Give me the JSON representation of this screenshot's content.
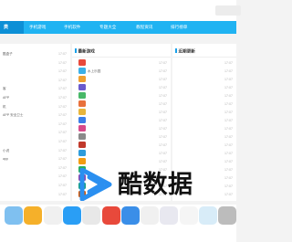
{
  "nav": {
    "items": [
      "手机游戏",
      "手机软件",
      "专题大全",
      "教程资讯",
      "排行榜单"
    ],
    "first": "类"
  },
  "left": {
    "rows": [
      {
        "tag": "",
        "name": "酷盒子",
        "date": "17:07"
      },
      {
        "tag": "",
        "name": "",
        "date": "17:07"
      },
      {
        "tag": "",
        "name": "",
        "date": "17:07"
      },
      {
        "tag": "",
        "name": "",
        "date": "17:07"
      },
      {
        "tag": "",
        "name": "客",
        "date": "17:07"
      },
      {
        "tag": "",
        "name": "APP",
        "date": "17:07"
      },
      {
        "tag": "",
        "name": "机",
        "date": "17:07"
      },
      {
        "tag": "",
        "name": "APP 安全卫士",
        "date": "17:07"
      },
      {
        "tag": "",
        "name": "",
        "date": "17:07"
      },
      {
        "tag": "",
        "name": "",
        "date": "17:07"
      },
      {
        "tag": "",
        "name": "",
        "date": "17:07"
      },
      {
        "tag": "",
        "name": "小说",
        "date": "17:07"
      },
      {
        "tag": "",
        "name": "app",
        "date": "17:07"
      },
      {
        "tag": "",
        "name": "",
        "date": "17:07"
      },
      {
        "tag": "",
        "name": "",
        "date": "17:07"
      },
      {
        "tag": "",
        "name": "",
        "date": "17:07"
      },
      {
        "tag": "",
        "name": "",
        "date": "17:07"
      }
    ]
  },
  "middle": {
    "title": "最新游戏",
    "subtitle": "",
    "rows": [
      {
        "name": "",
        "date": "17:07",
        "color": "#e8493b"
      },
      {
        "name": "水上乐园",
        "date": "17:07",
        "color": "#3bb0e8"
      },
      {
        "name": "",
        "date": "17:07",
        "color": "#f0a030"
      },
      {
        "name": "",
        "date": "17:07",
        "color": "#6a5acd"
      },
      {
        "name": "",
        "date": "17:07",
        "color": "#48b868"
      },
      {
        "name": "",
        "date": "17:07",
        "color": "#e8703b"
      },
      {
        "name": "",
        "date": "17:07",
        "color": "#e8b53b"
      },
      {
        "name": "",
        "date": "17:07",
        "color": "#3b7ee8"
      },
      {
        "name": "",
        "date": "17:07",
        "color": "#d84a8a"
      },
      {
        "name": "",
        "date": "17:07",
        "color": "#8a8a8a"
      },
      {
        "name": "",
        "date": "17:07",
        "color": "#c0392b"
      },
      {
        "name": "",
        "date": "17:07",
        "color": "#2e9cdb"
      },
      {
        "name": "",
        "date": "17:07",
        "color": "#f39c12"
      },
      {
        "name": "",
        "date": "17:07",
        "color": "#27ae60"
      },
      {
        "name": "",
        "date": "17:07",
        "color": "#8e44ad"
      },
      {
        "name": "",
        "date": "17:07",
        "color": "#16a085"
      },
      {
        "name": "",
        "date": "17:07",
        "color": "#d35400"
      }
    ]
  },
  "right": {
    "title": "近期更新",
    "rows": [
      {
        "name": "",
        "date": "17:07"
      },
      {
        "name": "",
        "date": "17:07"
      },
      {
        "name": "",
        "date": "17:07"
      },
      {
        "name": "",
        "date": "17:07"
      },
      {
        "name": "",
        "date": "17:07"
      },
      {
        "name": "",
        "date": "17:07"
      },
      {
        "name": "",
        "date": "17:07"
      },
      {
        "name": "",
        "date": "17:07"
      },
      {
        "name": "",
        "date": "17:07"
      },
      {
        "name": "",
        "date": "17:07"
      },
      {
        "name": "",
        "date": "17:07"
      },
      {
        "name": "",
        "date": "17:07"
      },
      {
        "name": "",
        "date": "17:07"
      },
      {
        "name": "",
        "date": "17:07"
      },
      {
        "name": "",
        "date": "17:07"
      },
      {
        "name": "",
        "date": "17:07"
      },
      {
        "name": "",
        "date": "17:07"
      }
    ]
  },
  "apps": [
    {
      "label": "",
      "color": "#7fc0f0"
    },
    {
      "label": "",
      "color": "#f5b02a"
    },
    {
      "label": "",
      "color": "#f0f0f0"
    },
    {
      "label": "",
      "color": "#2a9ef5"
    },
    {
      "label": "",
      "color": "#e8e8e8"
    },
    {
      "label": "",
      "color": "#e8493b"
    },
    {
      "label": "",
      "color": "#3a8ee8"
    },
    {
      "label": "",
      "color": "#f0f0f0"
    },
    {
      "label": "",
      "color": "#e8e8f0"
    },
    {
      "label": "",
      "color": "#f5f5f5"
    },
    {
      "label": "",
      "color": "#d8ecf8"
    },
    {
      "label": "",
      "color": "#bcbcbc"
    }
  ],
  "watermark": {
    "text": "酷数据",
    "color": "#2a8ff0"
  }
}
